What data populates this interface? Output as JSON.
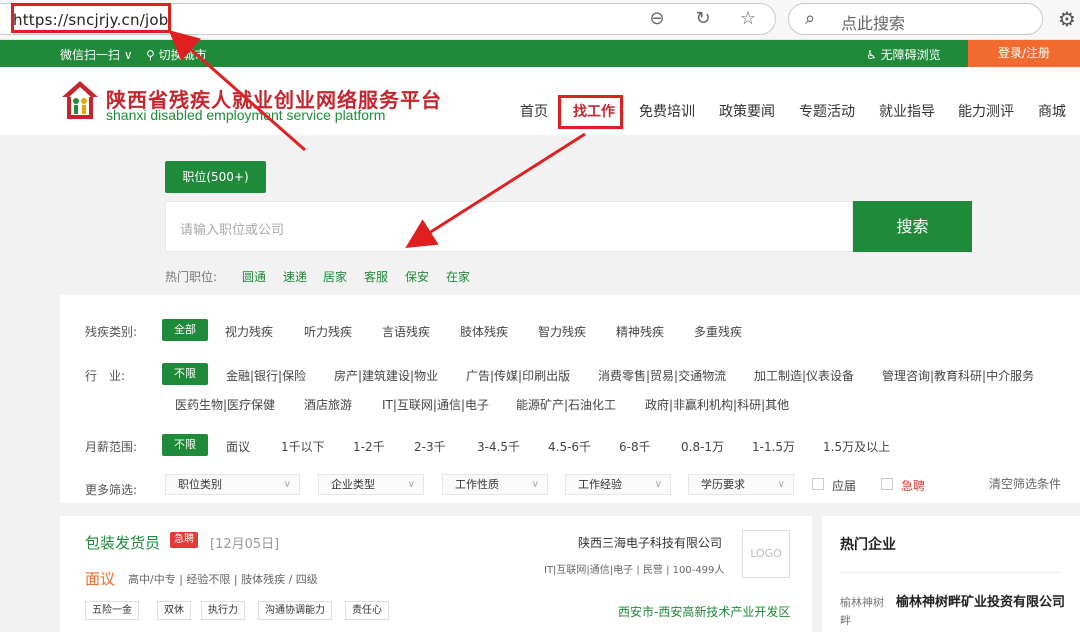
{
  "browser": {
    "url": "https://sncjrjy.cn/job",
    "search_placeholder": "点此搜索",
    "icons": [
      "zoom-out-icon",
      "refresh-icon",
      "star-icon",
      "settings-icon"
    ]
  },
  "topbar": {
    "wechat": "微信扫一扫 ∨",
    "city": "切换城市",
    "accessibility": "无障碍浏览",
    "login": "登录/注册"
  },
  "header": {
    "title": "陕西省残疾人就业创业网络服务平台",
    "subtitle": "shanxi disabled employment service platform",
    "nav": [
      "首页",
      "找工作",
      "免费培训",
      "政策要闻",
      "专题活动",
      "就业指导",
      "能力测评",
      "商城"
    ],
    "active_nav": "找工作"
  },
  "search": {
    "tab_label": "职位(500+)",
    "placeholder": "请输入职位或公司",
    "button": "搜索",
    "hot_label": "热门职位:",
    "hot_items": [
      "圆通",
      "速递",
      "居家",
      "客服",
      "保安",
      "在家"
    ]
  },
  "filters": {
    "disability": {
      "label": "残疾类别:",
      "selected": "全部",
      "options": [
        "视力残疾",
        "听力残疾",
        "言语残疾",
        "肢体残疾",
        "智力残疾",
        "精神残疾",
        "多重残疾"
      ]
    },
    "industry": {
      "label": "行　业:",
      "selected": "不限",
      "options_row1": [
        "金融|银行|保险",
        "房产|建筑建设|物业",
        "广告|传媒|印刷出版",
        "消费零售|贸易|交通物流",
        "加工制造|仪表设备",
        "管理咨询|教育科研|中介服务"
      ],
      "options_row2": [
        "医药生物|医疗保健",
        "酒店旅游",
        "IT|互联网|通信|电子",
        "能源矿产|石油化工",
        "政府|非赢利机构|科研|其他"
      ]
    },
    "salary": {
      "label": "月薪范围:",
      "selected": "不限",
      "options": [
        "面议",
        "1千以下",
        "1-2千",
        "2-3千",
        "3-4.5千",
        "4.5-6千",
        "6-8千",
        "0.8-1万",
        "1-1.5万",
        "1.5万及以上"
      ]
    },
    "more": {
      "label": "更多筛选:",
      "dropdowns": [
        "职位类别",
        "企业类型",
        "工作性质",
        "工作经验",
        "学历要求"
      ],
      "checkbox_graduate": "应届",
      "checkbox_urgent": "急聘",
      "clear": "清空筛选条件"
    }
  },
  "job": {
    "title": "包装发货员",
    "badge": "急聘",
    "date": "[12月05日]",
    "salary": "面议",
    "requirements": "高中/中专 | 经验不限 | 肢体残疾 / 四级",
    "company": "陕西三海电子科技有限公司",
    "company_meta": "IT|互联网|通信|电子 | 民营 | 100-499人",
    "logo_text": "LOGO",
    "tags": [
      "五险一金",
      "双休",
      "执行力",
      "沟通协调能力",
      "责任心"
    ],
    "location": "西安市-西安高新技术产业开发区"
  },
  "hot_companies": {
    "title": "热门企业",
    "items": [
      {
        "img_alt": "榆林神树畔",
        "name": "榆林神树畔矿业投资有限公司"
      }
    ]
  },
  "colors": {
    "brand_green": "#1f8a3a",
    "brand_red": "#c5262d",
    "accent_orange": "#f06b2d",
    "annotation_red": "#e02020"
  }
}
